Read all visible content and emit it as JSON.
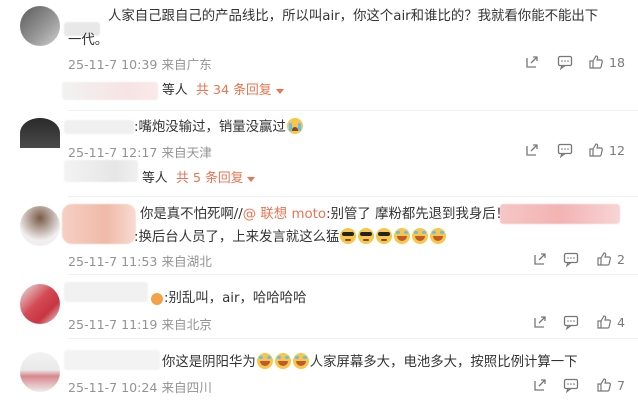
{
  "comments": [
    {
      "text_line1": "人家自己跟自己的产品线比，所以叫air，你这个air和谁比的？我就看你能不能出下",
      "text_line2": "一代。",
      "meta": "25-11-7 10:39 来自广东",
      "likes": "18",
      "reply_who": "等人",
      "reply_count": "共 34 条回复",
      "reply_icon": "chevron-down-icon"
    },
    {
      "text": ":嘴炮没输过，销量没赢过",
      "meta": "25-11-7 12:17 来自天津",
      "likes": "12",
      "reply_who": "等人",
      "reply_count": "共 5 条回复"
    },
    {
      "text_a": "你是真不怕死啊//",
      "mention": "@ 联想 moto",
      "text_b": ":别管了 摩粉都先退到我身后！",
      "text_line2": ":换后台人员了，上来发言就这么猛",
      "meta": "25-11-7 11:53 来自湖北",
      "likes": "2"
    },
    {
      "text": ":别乱叫，air，哈哈哈哈",
      "meta": "25-11-7 11:19 来自北京",
      "likes": "4"
    },
    {
      "text_a": "你这是阴阳华为",
      "text_b": "人家屏幕多大，电池多大，按照比例计算一下",
      "meta": "25-11-7 10:24 来自四川",
      "likes": "7"
    }
  ]
}
